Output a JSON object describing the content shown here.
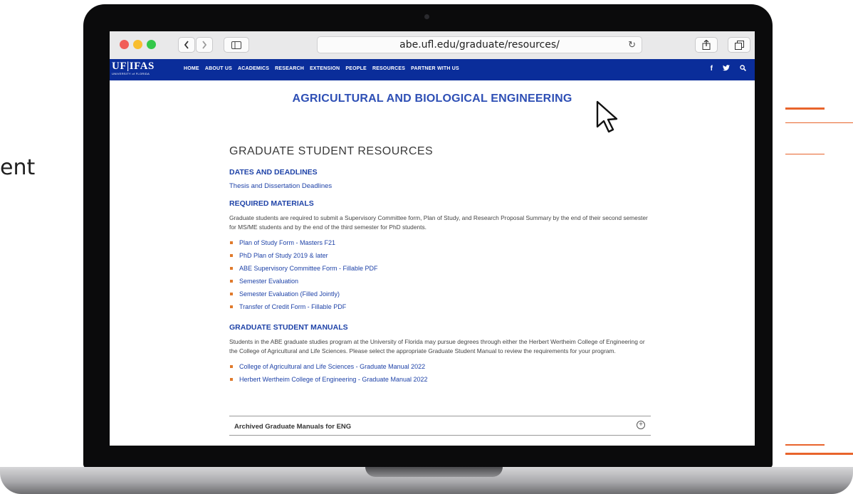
{
  "side_text": "ent",
  "browser": {
    "url": "abe.ufl.edu/graduate/resources/",
    "back_icon": "chevron-left-icon",
    "forward_icon": "chevron-right-icon",
    "sidebar_icon": "sidebar-icon",
    "reload_icon": "reload-icon",
    "share_icon": "share-icon",
    "tabs_icon": "tabs-icon",
    "colors": {
      "close": "#f15e58",
      "minimize": "#f8be2f",
      "zoom": "#34c84a"
    }
  },
  "site": {
    "logo": {
      "main": "UF|IFAS",
      "sub": "UNIVERSITY of FLORIDA"
    },
    "nav": [
      "HOME",
      "ABOUT US",
      "ACADEMICS",
      "RESEARCH",
      "EXTENSION",
      "PEOPLE",
      "RESOURCES",
      "PARTNER WITH US"
    ],
    "social": {
      "facebook": "f",
      "twitter": "🐦",
      "search": "⚲"
    },
    "title": "AGRICULTURAL AND BIOLOGICAL ENGINEERING",
    "brand_color": "#0a2d9a"
  },
  "page": {
    "heading": "GRADUATE STUDENT RESOURCES",
    "dates": {
      "heading": "DATES AND DEADLINES",
      "link": "Thesis and Dissertation Deadlines"
    },
    "required": {
      "heading": "REQUIRED MATERIALS",
      "text": "Graduate students are required to submit a Supervisory Committee form, Plan of Study, and Research Proposal Summary by the end of their second semester for MS/ME students and by the end of the third semester for PhD students.",
      "links": [
        "Plan of Study Form - Masters F21",
        "PhD Plan of Study 2019 & later",
        "ABE Supervisory Committee Form - Fillable PDF",
        "Semester Evaluation",
        "Semester Evaluation (Filled Jointly)",
        "Transfer of Credit Form - Fillable PDF"
      ]
    },
    "manuals": {
      "heading": "GRADUATE STUDENT MANUALS",
      "text": "Students in the ABE graduate studies program at the University of Florida may pursue degrees through either the Herbert Wertheim College of Engineering or the College of Agricultural and Life Sciences. Please select the appropriate Graduate Student Manual to review the requirements for your program.",
      "links": [
        "College of Agricultural and Life Sciences - Graduate Manual 2022",
        "Herbert Wertheim College of Engineering - Graduate Manual 2022"
      ]
    },
    "accordion": {
      "label": "Archived Graduate Manuals for ENG",
      "icon": "⊕"
    }
  }
}
